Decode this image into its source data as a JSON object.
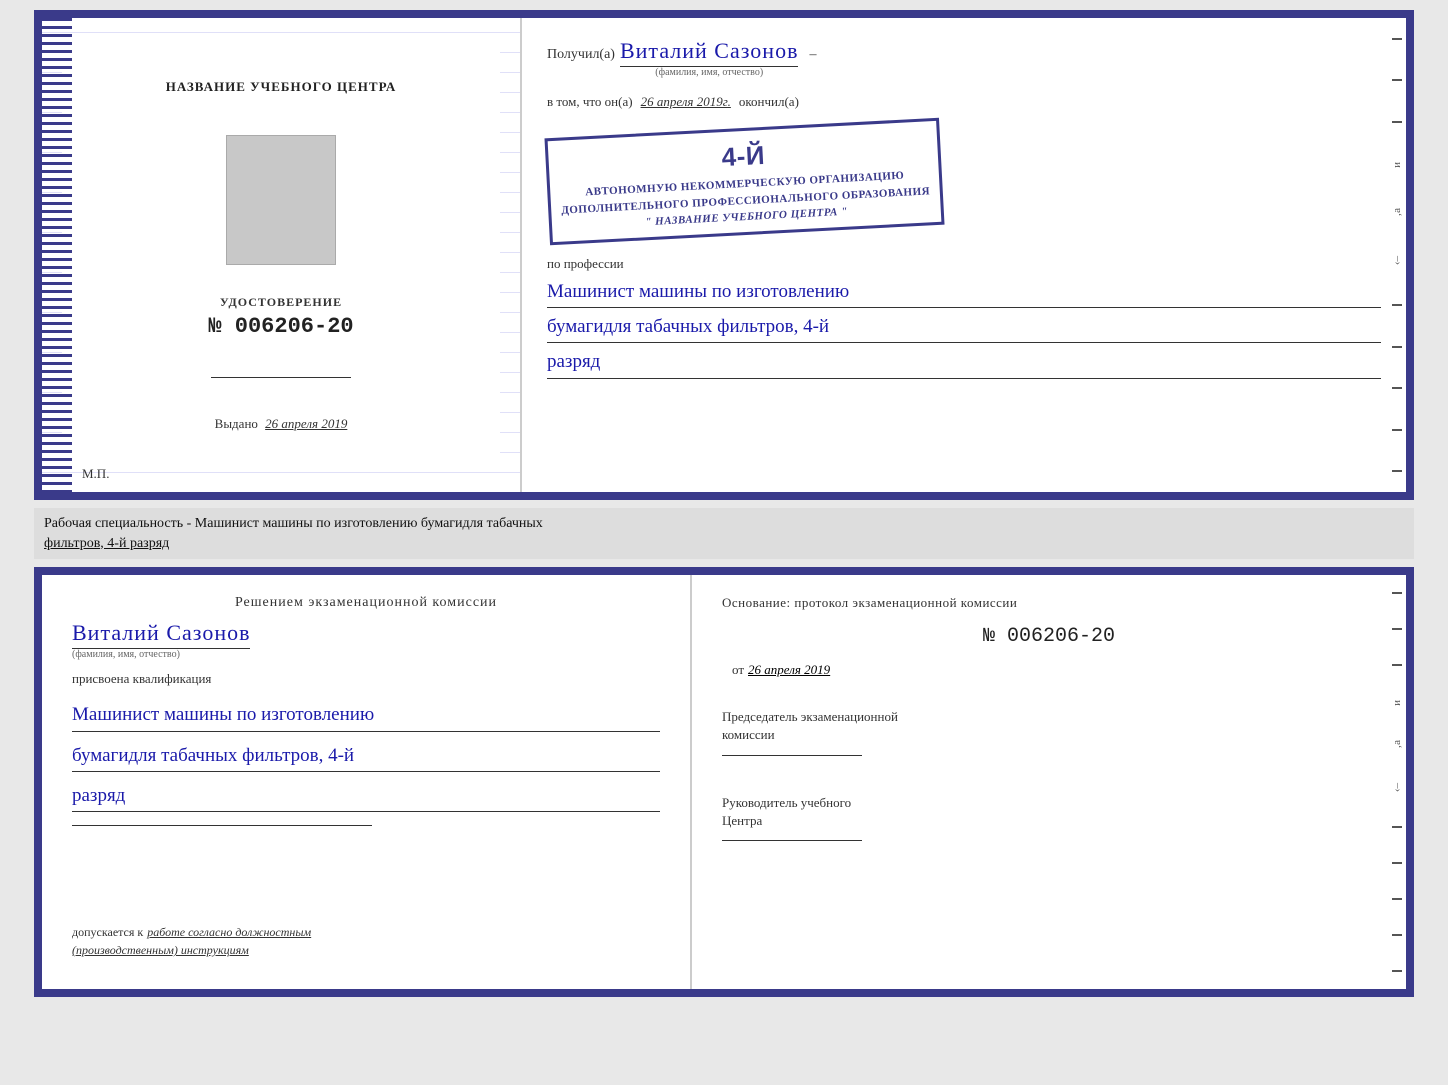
{
  "top_left": {
    "title": "НАЗВАНИЕ УЧЕБНОГО ЦЕНТРА",
    "cert_label": "УДОСТОВЕРЕНИЕ",
    "cert_number": "№ 006206-20",
    "issued_label": "Выдано",
    "issued_date": "26 апреля 2019",
    "mp_label": "М.П."
  },
  "top_right": {
    "received_label": "Получил(а)",
    "recipient_name": "Виталий Сазонов",
    "name_hint": "(фамилия, имя, отчество)",
    "dash": "–",
    "certifies_text": "в том, что он(а)",
    "date_text": "26 апреля 2019г.",
    "finished_label": "окончил(а)",
    "stamp_line1": "4-й",
    "stamp_line2": "АВТОНОМНУЮ НЕКОММЕРЧЕСКУЮ ОРГАНИЗАЦИЮ",
    "stamp_line3": "ДОПОЛНИТЕЛЬНОГО ПРОФЕССИОНАЛЬНОГО ОБРАЗОВАНИЯ",
    "stamp_line4": "\" НАЗВАНИЕ УЧЕБНОГО ЦЕНТРА \"",
    "profession_label": "по профессии",
    "profession_line1": "Машинист машины по изготовлению",
    "profession_line2": "бумагидля табачных фильтров, 4-й",
    "profession_line3": "разряд"
  },
  "label_strip": {
    "text": "Рабочая специальность - Машинист машины по изготовлению бумагидля табачных",
    "text2": "фильтров, 4-й разряд"
  },
  "bottom_left": {
    "decision_title": "Решением  экзаменационной  комиссии",
    "name": "Виталий Сазонов",
    "name_hint": "(фамилия, имя, отчество)",
    "qualification_label": "присвоена квалификация",
    "qual_line1": "Машинист машины по изготовлению",
    "qual_line2": "бумагидля табачных фильтров, 4-й",
    "qual_line3": "разряд",
    "allow_label": "допускается к",
    "allow_text": "работе согласно должностным",
    "allow_text2": "(производственным) инструкциям"
  },
  "bottom_right": {
    "basis_label": "Основание: протокол экзаменационной  комиссии",
    "protocol_number": "№  006206-20",
    "from_label": "от",
    "from_date": "26 апреля 2019",
    "chairman_label": "Председатель экзаменационной\nкомиссии",
    "director_label": "Руководитель учебного\nЦентра"
  },
  "side_dashes": [
    "–",
    "–",
    "–",
    "и",
    "‚а",
    "‹–",
    "–",
    "–",
    "–",
    "–",
    "–",
    "–"
  ]
}
